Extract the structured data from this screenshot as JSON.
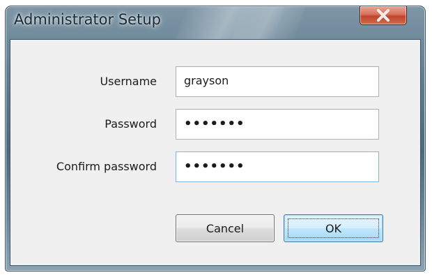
{
  "window": {
    "title": "Administrator Setup",
    "close_icon": "close-icon"
  },
  "form": {
    "username": {
      "label": "Username",
      "value": "grayson"
    },
    "password": {
      "label": "Password",
      "value": "•••••••"
    },
    "confirm_password": {
      "label": "Confirm password",
      "value": "•••••••"
    }
  },
  "buttons": {
    "cancel_label": "Cancel",
    "ok_label": "OK"
  },
  "colors": {
    "close_button": "#c9543b",
    "default_button_border": "#3c7fb1",
    "focus_border": "#7eb4ea"
  }
}
